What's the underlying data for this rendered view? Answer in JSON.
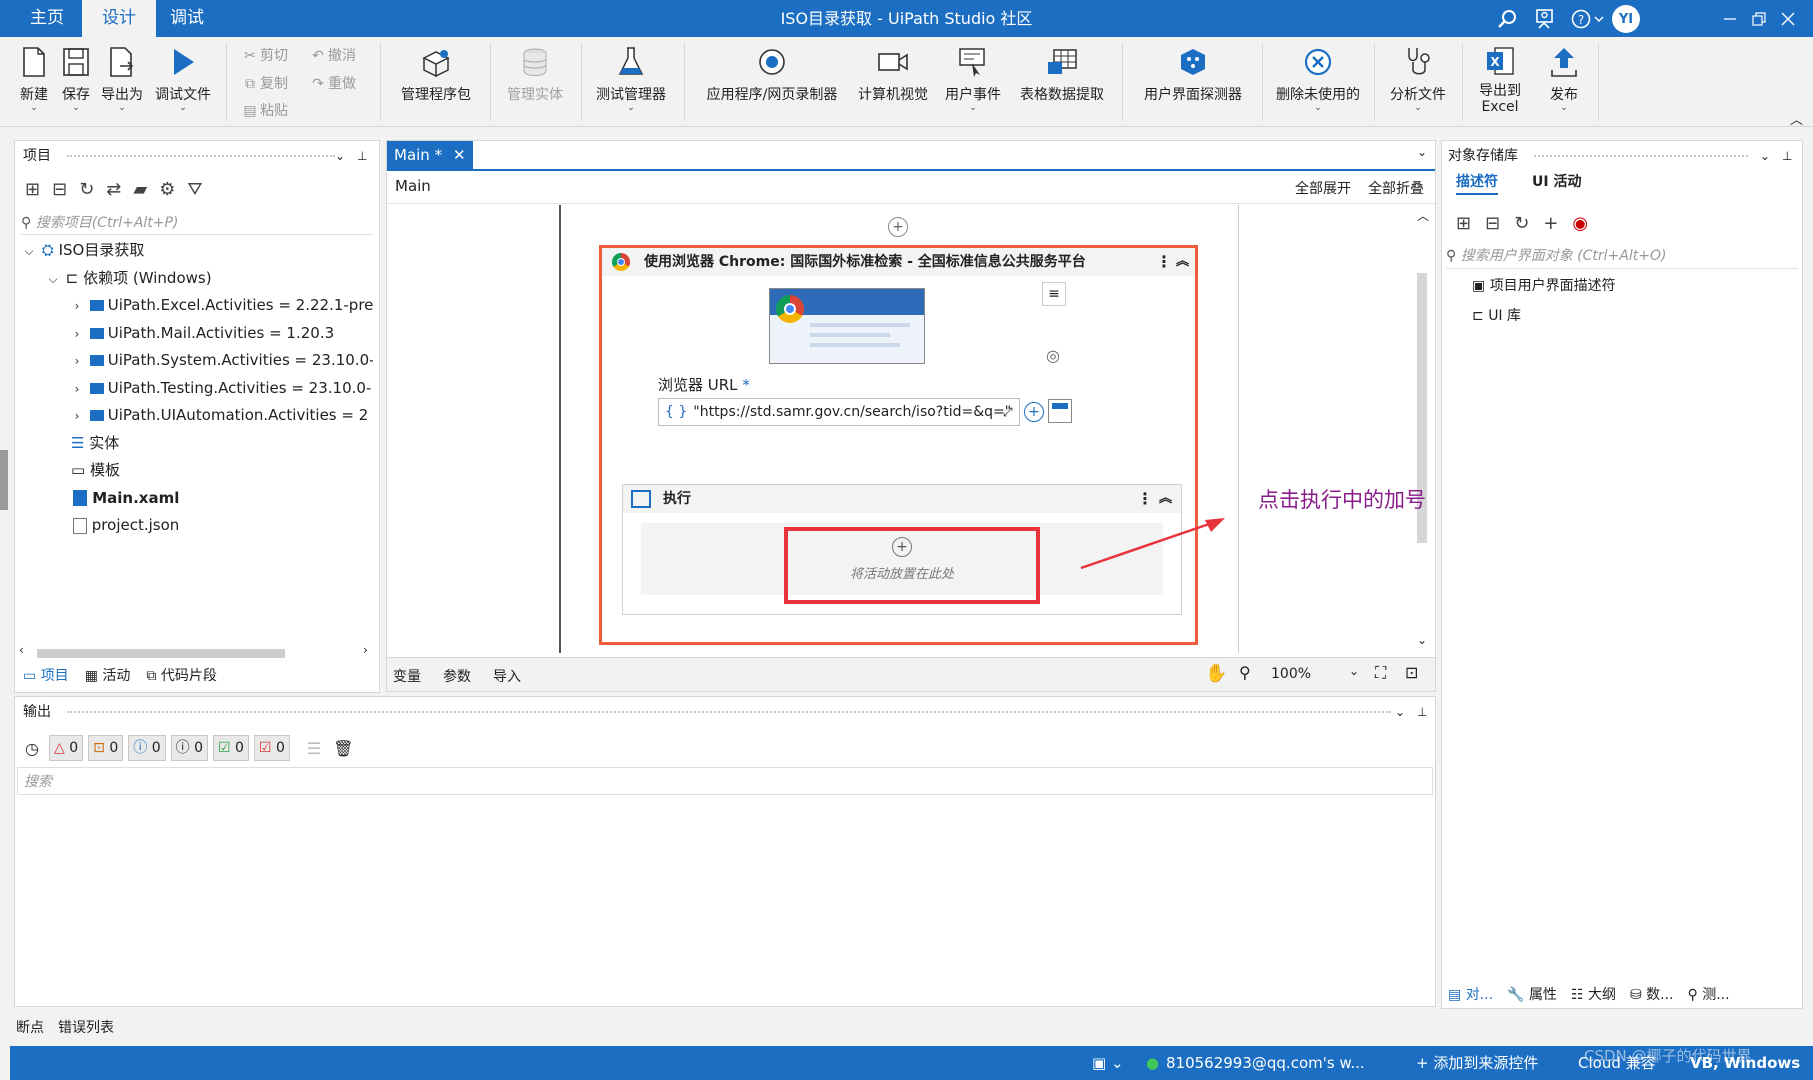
{
  "titlebar": {
    "tabs": [
      "主页",
      "设计",
      "调试"
    ],
    "active_tab": "设计",
    "title": "ISO目录获取 - UiPath Studio 社区",
    "user_initials": "YI",
    "icons": [
      "search-icon",
      "feedback-icon",
      "help-icon",
      "minimize-icon",
      "restore-icon",
      "close-icon"
    ],
    "accent": "#1b6ec2"
  },
  "ribbon": {
    "new": "新建",
    "save": "保存",
    "export": "导出为",
    "debug_file": "调试文件",
    "cut": "剪切",
    "copy": "复制",
    "paste": "粘贴",
    "undo": "撤消",
    "redo": "重做",
    "manage_packages": "管理程序包",
    "manage_entities": "管理实体",
    "test_manager": "测试管理器",
    "recorder": "应用程序/网页录制器",
    "computer_vision": "计算机视觉",
    "user_events": "用户事件",
    "table_extraction": "表格数据提取",
    "ui_explorer": "用户界面探测器",
    "remove_unused": "删除未使用的",
    "analyze_file": "分析文件",
    "export_excel_1": "导出到",
    "export_excel_2": "Excel",
    "publish": "发布"
  },
  "project_panel": {
    "title": "项目",
    "search_placeholder": "搜索项目(Ctrl+Alt+P)",
    "root": "ISO目录获取",
    "dependencies": "依赖项  (Windows)",
    "packages": [
      "UiPath.Excel.Activities = 2.22.1-pre",
      "UiPath.Mail.Activities = 1.20.3",
      "UiPath.System.Activities = 23.10.0-",
      "UiPath.Testing.Activities = 23.10.0-",
      "UiPath.UIAutomation.Activities = 2"
    ],
    "entities": "实体",
    "templates": "模板",
    "main_file": "Main.xaml",
    "project_file": "project.json",
    "bottom_tabs": [
      "项目",
      "活动",
      "代码片段"
    ]
  },
  "designer": {
    "doc_tab": "Main *",
    "breadcrumb": "Main",
    "expand_all": "全部展开",
    "collapse_all": "全部折叠",
    "browser_activity_title": "使用浏览器 Chrome: 国际国外标准检索 - 全国标准信息公共服务平台",
    "url_label": "浏览器 URL",
    "required_mark": "*",
    "url_value": "\"https://std.samr.gov.cn/search/iso?tid=&q=\"",
    "execute_title": "执行",
    "drop_hint": "将活动放置在此处",
    "annotation": "点击执行中的加号",
    "bottom_tabs": [
      "变量",
      "参数",
      "导入"
    ],
    "zoom": "100%"
  },
  "object_repo": {
    "title": "对象存储库",
    "tabs": [
      "描述符",
      "UI 活动"
    ],
    "search_placeholder": "搜索用户界面对象 (Ctrl+Alt+O)",
    "items": [
      "项目用户界面描述符",
      "UI 库"
    ],
    "bottom_tabs": [
      "对...",
      "属性",
      "大纲",
      "数...",
      "测..."
    ]
  },
  "output_panel": {
    "title": "输出",
    "counts": [
      "0",
      "0",
      "0",
      "0",
      "0",
      "0"
    ],
    "search_placeholder": "搜索"
  },
  "debug_tabs": [
    "断点",
    "错误列表"
  ],
  "statusbar": {
    "account": "810562993@qq.com's w...",
    "add_source": "添加到来源控件",
    "compat": "Cloud 兼容",
    "lang": "VB, Windows",
    "watermark": "CSDN @椰子的代码世界"
  }
}
